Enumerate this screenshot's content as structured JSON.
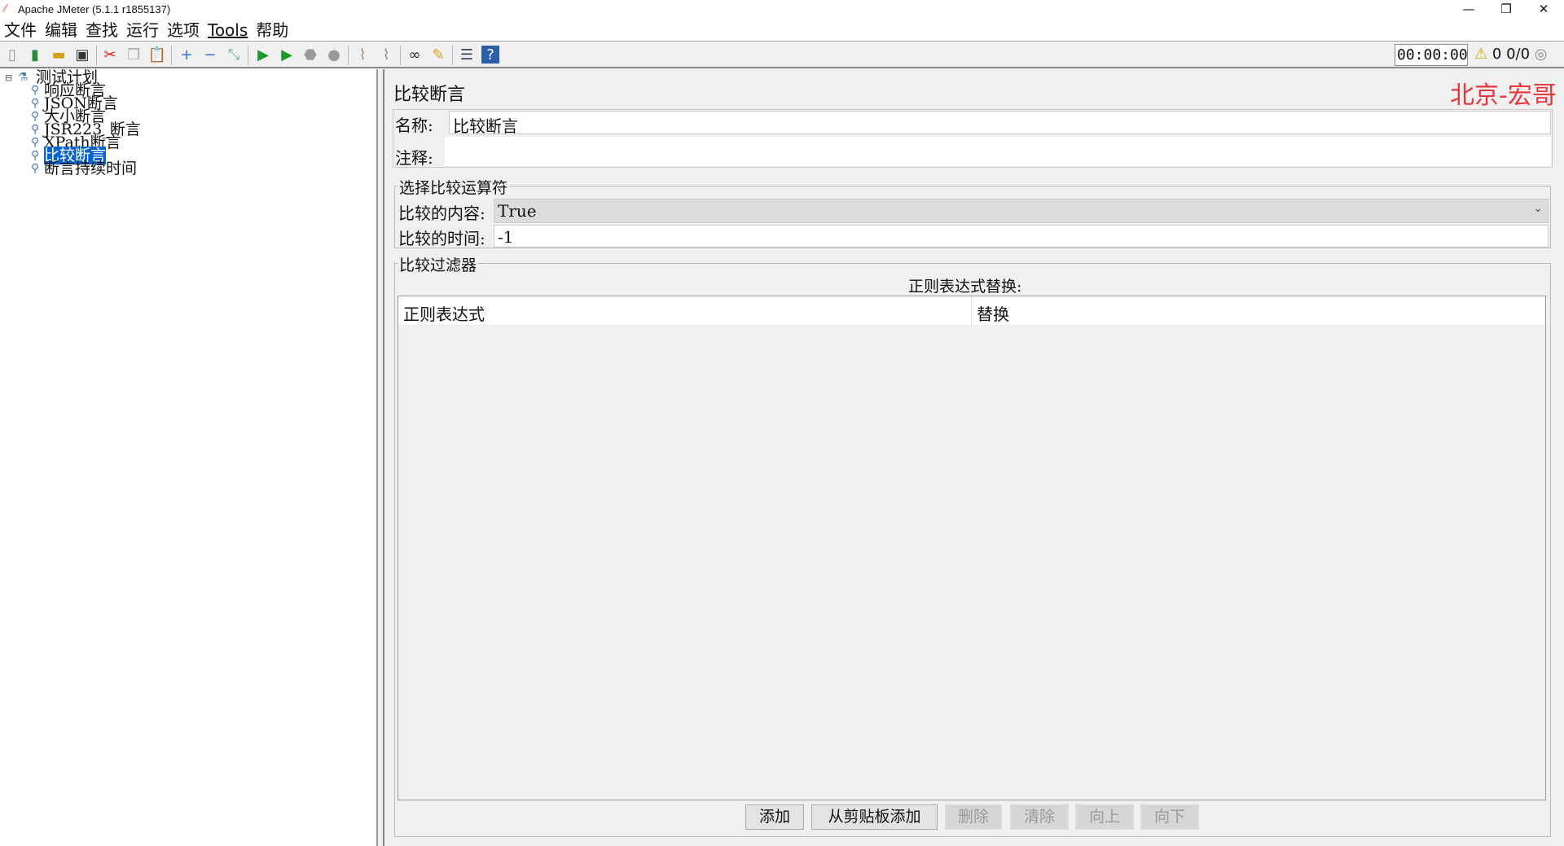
{
  "window": {
    "title": "Apache JMeter (5.1.1 r1855137)",
    "minimize": "—",
    "restore": "❐",
    "close": "✕"
  },
  "menu": [
    "文件",
    "编辑",
    "查找",
    "运行",
    "选项",
    "Tools",
    "帮助"
  ],
  "toolbar": {
    "timer": "00:00:00",
    "warnings": "0",
    "threads": "0/0"
  },
  "tree": {
    "root": "测试计划",
    "items": [
      "响应断言",
      "JSON断言",
      "大小断言",
      "JSR223_断言",
      "XPath断言",
      "比较断言",
      "断言持续时间"
    ],
    "selected": "比较断言"
  },
  "panel": {
    "title": "比较断言",
    "watermark": "北京-宏哥",
    "name_label": "名称:",
    "name_value": "比较断言",
    "comment_label": "注释:",
    "comment_value": "",
    "operator_group": "选择比较运算符",
    "content_label": "比较的内容:",
    "content_value": "True",
    "time_label": "比较的时间:",
    "time_value": "-1",
    "filter_group": "比较过滤器",
    "table_title": "正则表达式替换:",
    "columns": [
      "正则表达式",
      "替换"
    ],
    "buttons": {
      "add": "添加",
      "add_clipboard": "从剪贴板添加",
      "delete": "删除",
      "clear": "清除",
      "up": "向上",
      "down": "向下"
    }
  },
  "colors": {
    "selection": "#0a64d0",
    "watermark": "#e8363f"
  }
}
